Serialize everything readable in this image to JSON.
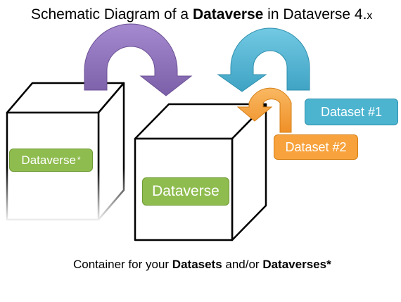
{
  "title": {
    "prefix": "Schematic Diagram of a ",
    "bold": "Dataverse",
    "middle": " in Dataverse 4.",
    "suffix": "x"
  },
  "labels": {
    "dataverse_small": "Dataverse",
    "dataverse_small_mark": "*",
    "dataverse_big": "Dataverse",
    "dataset_1": "Dataset #1",
    "dataset_2": "Dataset #2"
  },
  "caption": {
    "prefix": "Container for your ",
    "bold1": "Datasets",
    "middle": " and/or ",
    "bold2": "Dataverses*"
  },
  "colors": {
    "purple_arrow": "#8e72b8",
    "blue_arrow": "#55b6d4",
    "orange_arrow": "#f7a23c",
    "label_green": "#8fbc4f",
    "label_blue": "#4db4d0",
    "label_orange": "#f7a23c"
  },
  "icons": [
    "cube-outline",
    "curved-arrow"
  ]
}
